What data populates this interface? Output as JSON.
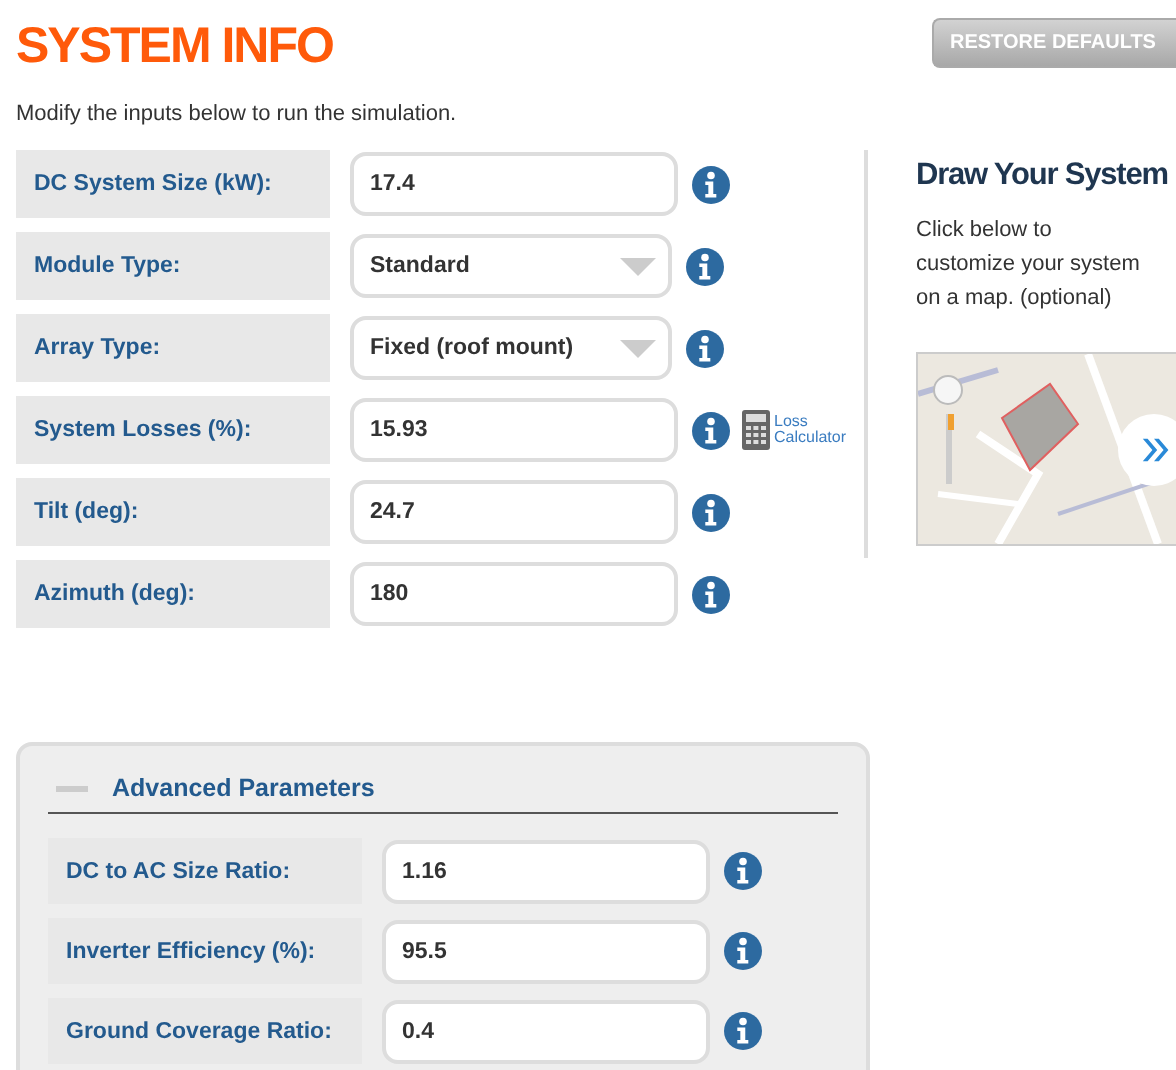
{
  "title": "SYSTEM INFO",
  "restore_button": "RESTORE DEFAULTS",
  "intro": "Modify the inputs below to run the simulation.",
  "fields": [
    {
      "label": "DC System Size (kW):",
      "kind": "text",
      "value": "17.4"
    },
    {
      "label": "Module Type:",
      "kind": "select",
      "value": "Standard"
    },
    {
      "label": "Array Type:",
      "kind": "select",
      "value": "Fixed (roof mount)"
    },
    {
      "label": "System Losses (%):",
      "kind": "text",
      "value": "15.93",
      "link": [
        "Loss",
        "Calculator"
      ]
    },
    {
      "label": "Tilt (deg):",
      "kind": "text",
      "value": "24.7"
    },
    {
      "label": "Azimuth (deg):",
      "kind": "text",
      "value": "180"
    }
  ],
  "draw_panel": {
    "title": "Draw Your System",
    "text": "Click below to customize your system on a map. (optional)"
  },
  "advanced": {
    "title": "Advanced Parameters",
    "expanded": true,
    "fields": [
      {
        "label": "DC to AC Size Ratio:",
        "kind": "text",
        "value": "1.16"
      },
      {
        "label": "Inverter Efficiency (%):",
        "kind": "text",
        "value": "95.5"
      },
      {
        "label": "Ground Coverage Ratio:",
        "kind": "text",
        "value": "0.4"
      }
    ]
  }
}
